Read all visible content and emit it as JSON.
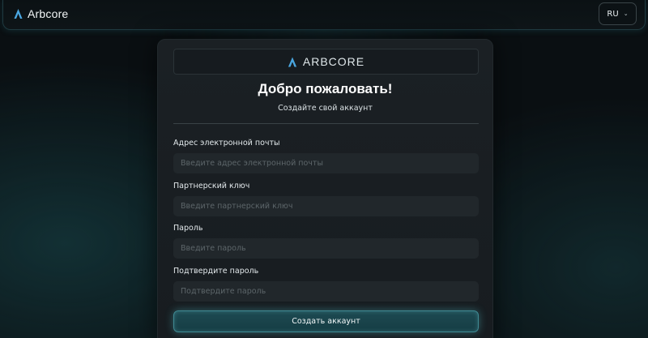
{
  "header": {
    "brand_name": "Arbcore",
    "language": "RU",
    "logo_icon": "triangle-logo-icon",
    "chevron_icon": "chevron-down-icon"
  },
  "card": {
    "logo_word": "ARBCORE",
    "title": "Добро пожаловать!",
    "subtitle": "Создайте свой аккаунт",
    "fields": [
      {
        "label": "Адрес электронной почты",
        "placeholder": "Введите адрес электронной почты",
        "value": ""
      },
      {
        "label": "Партнерский ключ",
        "placeholder": "Введите партнерский ключ",
        "value": ""
      },
      {
        "label": "Пароль",
        "placeholder": "Введите пароль",
        "value": ""
      },
      {
        "label": "Подтвердите пароль",
        "placeholder": "Подтвердите пароль",
        "value": ""
      }
    ],
    "submit_label": "Создать аккаунт"
  },
  "colors": {
    "background": "#0a0f12",
    "accent": "#3f8a93",
    "logo_blue": "#4aa6e0",
    "card": "#1b2024",
    "input": "#21272b"
  }
}
